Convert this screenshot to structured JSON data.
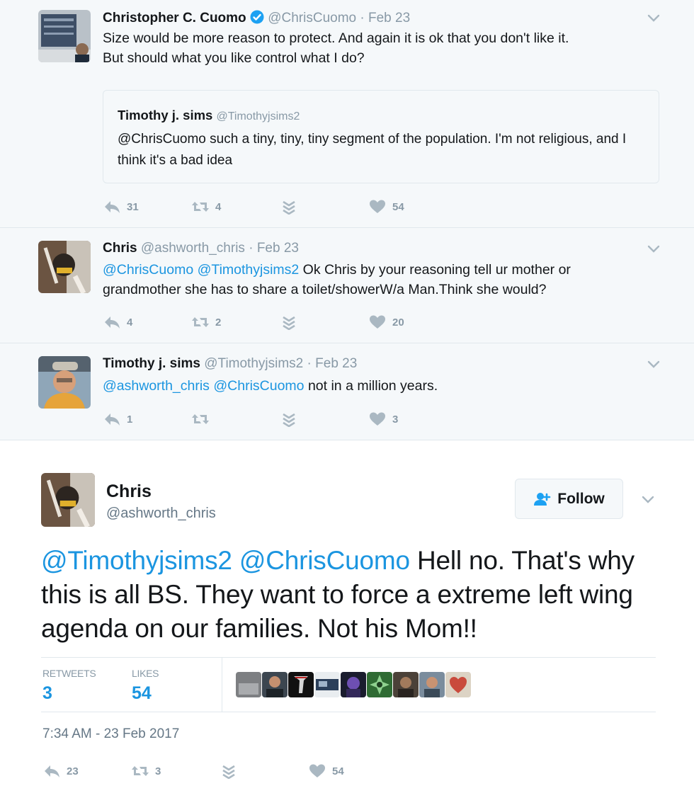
{
  "thread": [
    {
      "name": "Christopher C. Cuomo",
      "verified": true,
      "handle": "@ChrisCuomo",
      "separator": "·",
      "time": "Feb 23",
      "body_line1": "Size would be more reason to protect. And again it is ok that you don't like it.",
      "body_line2": "But should what you like control what I do?",
      "quote": {
        "name": "Timothy j. sims",
        "handle": "@Timothyjsims2",
        "text": "@ChrisCuomo such a tiny, tiny, tiny segment of the population. I'm not religious, and I think it's a bad idea"
      },
      "replies": "31",
      "retweets": "4",
      "likes": "54"
    },
    {
      "name": "Chris",
      "handle": "@ashworth_chris",
      "separator": "·",
      "time": "Feb 23",
      "mention1": "@ChrisCuomo",
      "mention2": "@Timothyjsims2",
      "text": " Ok Chris by your reasoning tell ur mother or grandmother she has to share a toilet/showerW/a Man.Think she would?",
      "replies": "4",
      "retweets": "2",
      "likes": "20"
    },
    {
      "name": "Timothy j. sims",
      "handle": "@Timothyjsims2",
      "separator": "·",
      "time": "Feb 23",
      "mention1": "@ashworth_chris",
      "mention2": "@ChrisCuomo",
      "text": " not in a million years.",
      "replies": "1",
      "retweets": "",
      "likes": "3"
    }
  ],
  "main": {
    "name": "Chris",
    "handle": "@ashworth_chris",
    "follow_label": "Follow",
    "mention1": "@Timothyjsims2",
    "mention2": "@ChrisCuomo",
    "text": " Hell no. That's why this is all BS. They want to force a extreme left wing agenda on our families. Not his Mom!!",
    "retweets_label": "RETWEETS",
    "retweets_value": "3",
    "likes_label": "LIKES",
    "likes_value": "54",
    "timestamp": "7:34 AM - 23 Feb 2017",
    "replies": "23",
    "retweets": "3",
    "likes": "54"
  },
  "colors": {
    "link": "#1b95e0",
    "thread_bg": "#f5f8fa",
    "muted": "#8899a6",
    "border": "#e1e8ed"
  },
  "icons": [
    "reply-icon",
    "retweet-icon",
    "direct-message-icon",
    "heart-icon",
    "chevron-down-icon",
    "verified-badge-icon",
    "follow-person-icon"
  ]
}
